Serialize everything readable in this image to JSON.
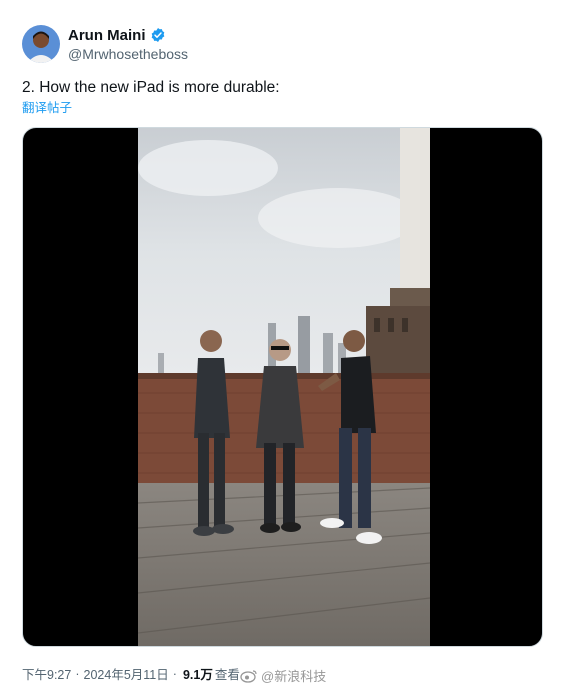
{
  "user": {
    "display_name": "Arun Maini",
    "handle": "@Mrwhosetheboss",
    "verified_icon": "verified-badge-icon"
  },
  "tweet": {
    "text": "2. How the new iPad is more durable:",
    "translate_label": "翻译帖子"
  },
  "media": {
    "type": "video-still",
    "description_icon": "video-frame"
  },
  "footer": {
    "time": "下午9:27",
    "separator": "·",
    "date": "2024年5月11日",
    "views_count": "9.1万",
    "views_label": "查看"
  },
  "watermark": {
    "text": "@新浪科技"
  },
  "colors": {
    "link": "#1d9bf0",
    "verified": "#1d9bf0",
    "muted": "#536471"
  }
}
